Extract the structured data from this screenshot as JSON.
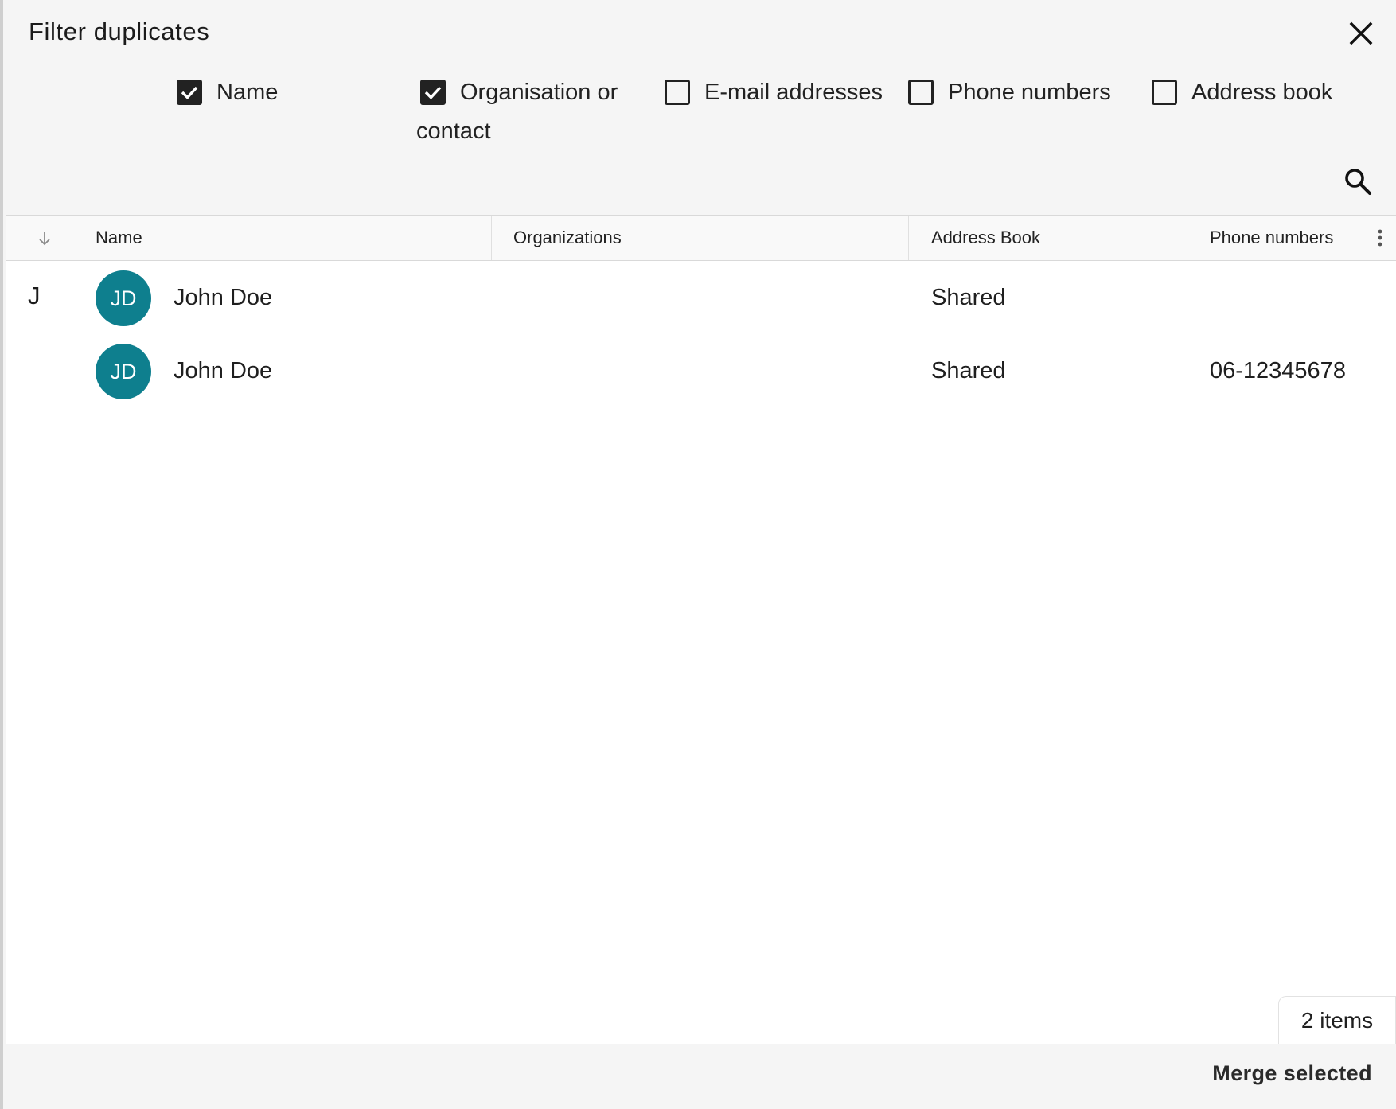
{
  "dialog": {
    "title": "Filter duplicates",
    "close_icon": "close-icon",
    "search_icon": "search-icon"
  },
  "filters": [
    {
      "label": "Name",
      "checked": true
    },
    {
      "label_line1": "Organisation or",
      "label_line2": "contact",
      "checked": true
    },
    {
      "label": "E-mail addresses",
      "checked": false
    },
    {
      "label": "Phone numbers",
      "checked": false
    },
    {
      "label": "Address book",
      "checked": false
    }
  ],
  "table": {
    "sort_icon": "arrow-down-icon",
    "columns": [
      "Name",
      "Organizations",
      "Address Book",
      "Phone numbers"
    ],
    "menu_icon": "vertical-dots-icon",
    "group_letter": "J",
    "rows": [
      {
        "initials": "JD",
        "name": "John Doe",
        "organization": "",
        "address_book": "Shared",
        "phone": ""
      },
      {
        "initials": "JD",
        "name": "John Doe",
        "organization": "",
        "address_book": "Shared",
        "phone": "06-12345678"
      }
    ]
  },
  "footer": {
    "count": "2 items",
    "merge_label": "Merge selected"
  },
  "colors": {
    "avatar": "#0e7f8e",
    "background": "#f5f5f5"
  }
}
